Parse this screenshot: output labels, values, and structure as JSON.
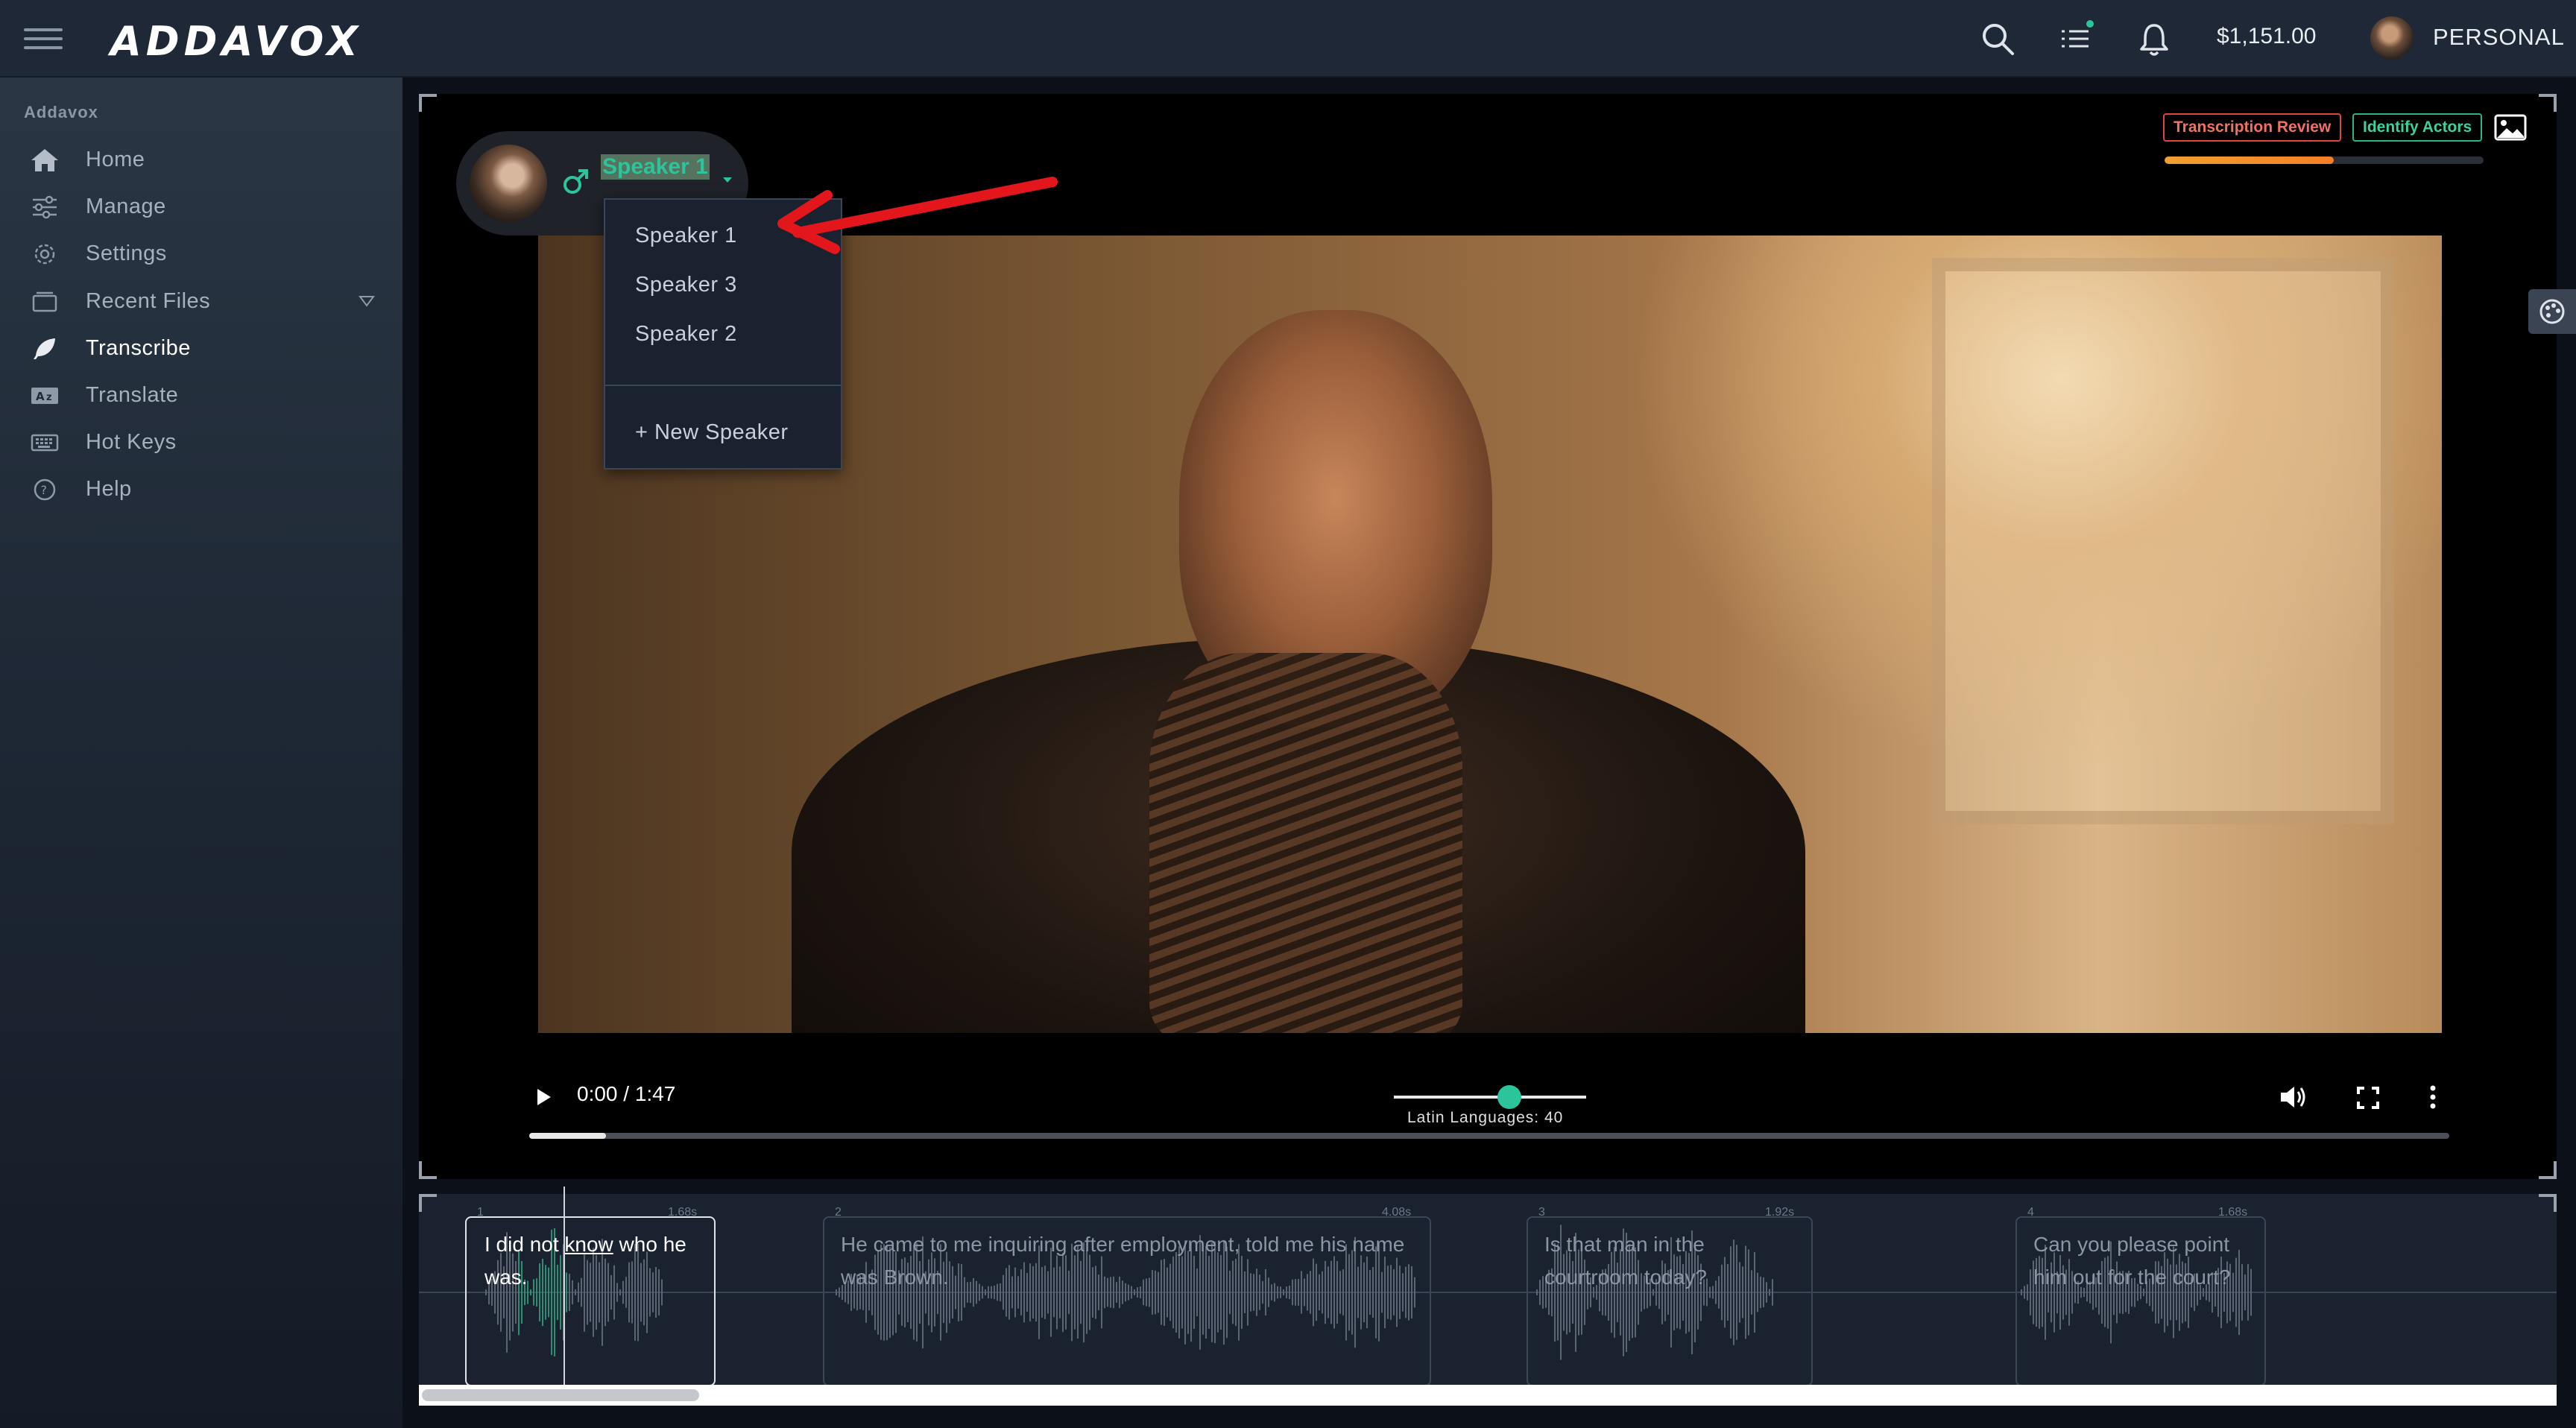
{
  "app": {
    "logo": "ADDAVOX"
  },
  "topbar": {
    "balance": "$1,151.00",
    "account_label": "PERSONAL",
    "icons": [
      "menu-icon",
      "search-icon",
      "task-list-icon",
      "bell-icon"
    ]
  },
  "sidebar": {
    "title": "Addavox",
    "items": [
      {
        "label": "Home",
        "icon": "home-icon"
      },
      {
        "label": "Manage",
        "icon": "sliders-icon"
      },
      {
        "label": "Settings",
        "icon": "gear-icon"
      },
      {
        "label": "Recent Files",
        "icon": "folder-icon"
      },
      {
        "label": "Transcribe",
        "icon": "feather-icon",
        "active": true
      },
      {
        "label": "Translate",
        "icon": "translate-icon"
      },
      {
        "label": "Hot Keys",
        "icon": "keyboard-icon"
      },
      {
        "label": "Help",
        "icon": "help-circle-icon"
      }
    ]
  },
  "speaker": {
    "current": "Speaker 1",
    "options": [
      "Speaker 1",
      "Speaker 3",
      "Speaker 2"
    ],
    "new_label": "+ New Speaker"
  },
  "badges": {
    "review": "Transcription Review",
    "actors": "Identify Actors",
    "review_color": "#e0453b",
    "actors_color": "#2cb386"
  },
  "review_progress": 0.53,
  "player": {
    "time": "0:00 / 1:47",
    "language_label": "Latin Languages: 40",
    "language_value": 0.6,
    "played_fraction": 0.04
  },
  "segments": [
    {
      "num": "1",
      "duration": "1.68s",
      "text_before": "I did not ",
      "text_link": "know",
      "text_after": " who he was."
    },
    {
      "num": "2",
      "duration": "4.08s",
      "text": "He came to me inquiring after employment, told me his name was Brown."
    },
    {
      "num": "3",
      "duration": "1.92s",
      "text": "Is that man in the courtroom today?"
    },
    {
      "num": "4",
      "duration": "1.68s",
      "text": "Can you please point him out for the court?"
    }
  ],
  "colors": {
    "accent": "#2cc49a",
    "annotation_arrow": "#e3161c"
  }
}
